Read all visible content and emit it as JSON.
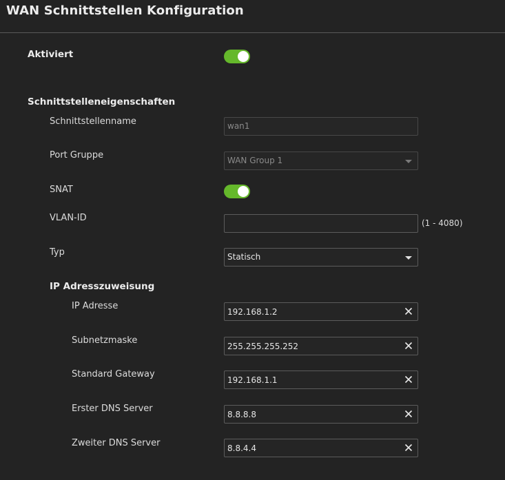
{
  "header": {
    "title": "WAN Schnittstellen Konfiguration"
  },
  "enabled": {
    "label": "Aktiviert",
    "on": true
  },
  "properties": {
    "heading": "Schnittstelleneigenschaften",
    "interface_name": {
      "label": "Schnittstellenname",
      "value": "wan1"
    },
    "port_group": {
      "label": "Port Gruppe",
      "value": "WAN Group 1"
    },
    "snat": {
      "label": "SNAT",
      "on": true
    },
    "vlan_id": {
      "label": "VLAN-ID",
      "value": "",
      "range": "(1 - 4080)"
    },
    "type": {
      "label": "Typ",
      "value": "Statisch"
    }
  },
  "ip_assignment": {
    "heading": "IP Adresszuweisung",
    "ip_address": {
      "label": "IP Adresse",
      "value": "192.168.1.2"
    },
    "subnet_mask": {
      "label": "Subnetzmaske",
      "value": "255.255.255.252"
    },
    "gateway": {
      "label": "Standard Gateway",
      "value": "192.168.1.1"
    },
    "dns1": {
      "label": "Erster DNS Server",
      "value": "8.8.8.8"
    },
    "dns2": {
      "label": "Zweiter DNS Server",
      "value": "8.8.4.4"
    }
  },
  "colors": {
    "background": "#232323",
    "toggle_on": "#65b82b",
    "border": "#5c5c5c"
  }
}
